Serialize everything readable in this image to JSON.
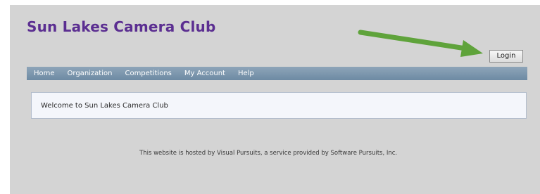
{
  "header": {
    "site_title": "Sun Lakes Camera Club",
    "login_label": "Login"
  },
  "nav": {
    "items": [
      {
        "label": "Home"
      },
      {
        "label": "Organization"
      },
      {
        "label": "Competitions"
      },
      {
        "label": "My Account"
      },
      {
        "label": "Help"
      }
    ]
  },
  "main": {
    "welcome_text": "Welcome to Sun Lakes Camera Club"
  },
  "footer": {
    "text": "This website is hosted by Visual Pursuits, a service provided by Software Pursuits, Inc."
  },
  "annotation": {
    "icon": "arrow-pointing-right-icon",
    "color": "#5fa33b"
  },
  "colors": {
    "title": "#5b2e91",
    "nav_bar": "#7d97ae",
    "background": "#d4d4d4",
    "panel": "#f4f6fb"
  }
}
